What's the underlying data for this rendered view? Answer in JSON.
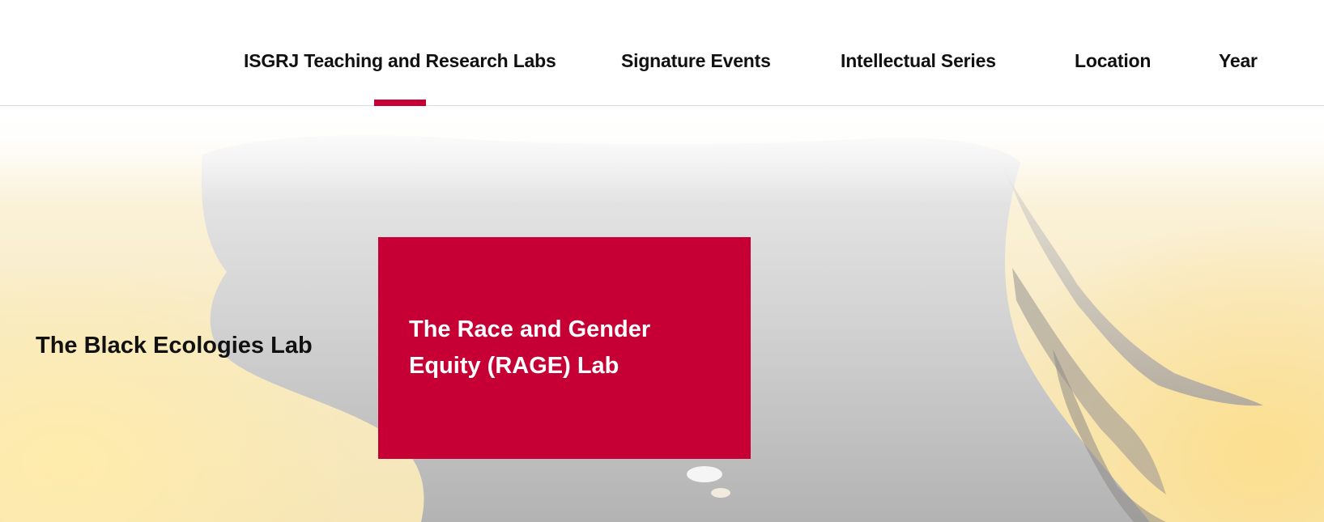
{
  "nav": {
    "items": [
      {
        "label": "ISGRJ Teaching and Research Labs",
        "active": true
      },
      {
        "label": "Signature Events",
        "active": false
      },
      {
        "label": "Intellectual Series",
        "active": false
      },
      {
        "label": "Location",
        "active": false
      },
      {
        "label": "Year",
        "active": false
      }
    ],
    "accent_color": "#c60034"
  },
  "hero": {
    "labs": [
      {
        "label": "The Black Ecologies Lab"
      },
      {
        "label": "The Race and Gender Equity (RAGE) Lab",
        "highlighted": true
      }
    ],
    "card_color": "#c60034"
  }
}
